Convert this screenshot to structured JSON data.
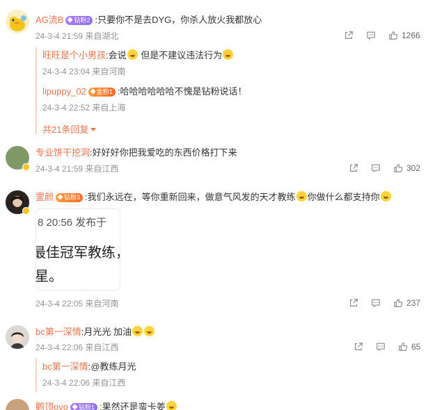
{
  "comments": [
    {
      "user": "AG流B",
      "fan_badge": "钻粉2",
      "text": ":只要你不是去DYG，你杀人放火我都放心",
      "time": "24-3-4 21:59",
      "location": "来自湖北",
      "likes": "1266",
      "replies": [
        {
          "user": "旺旺是个小男孩",
          "text": ":会说",
          "text2": "但是不建议违法行为",
          "time": "24-3-4 23:04",
          "location": "来自河南"
        },
        {
          "user": "lipuppy_02",
          "fan_badge": "金粉1",
          "text": ":哈哈哈哈哈哈不愧是钻粉说话！",
          "time": "24-3-4 22:52",
          "location": "来自上海"
        }
      ],
      "more_replies": "共21条回复"
    },
    {
      "user": "专业饼干挖洞",
      "text": ":好好好你把我爱吃的东西价格打下来",
      "time": "24-3-4 21:59",
      "location": "来自江西",
      "likes": "302"
    },
    {
      "user": "霊颜",
      "fan_badge": "钻粉3",
      "text": ":我们永远在，等你重新回来，做意气风发的天才教练",
      "text2": "你做什么都支持你",
      "image_text": [
        "8 20:56  发布于",
        "最佳冠军教练，",
        "星。"
      ],
      "time": "24-3-4 22:05",
      "location": "来自河南",
      "likes": "237"
    },
    {
      "user": "bc第一深情",
      "text": ":月光光 加油",
      "time": "24-3-4 22:06",
      "location": "来自江西",
      "likes": "65",
      "replies": [
        {
          "user": "bc第一深情",
          "text": ":@教练月光",
          "time": "24-3-4 22:06",
          "location": "来自江西"
        }
      ]
    },
    {
      "user": "鹳顶ovo",
      "fan_badge": "钻粉1",
      "text": ":果然还是蛮卡姜"
    }
  ],
  "icons": {
    "share": "share-icon",
    "comment": "comment-icon",
    "like": "like-icon"
  },
  "colors": {
    "username": "#eb7350",
    "meta": "#939393",
    "text": "#333333",
    "reply_bar": "#f3d6c8"
  }
}
